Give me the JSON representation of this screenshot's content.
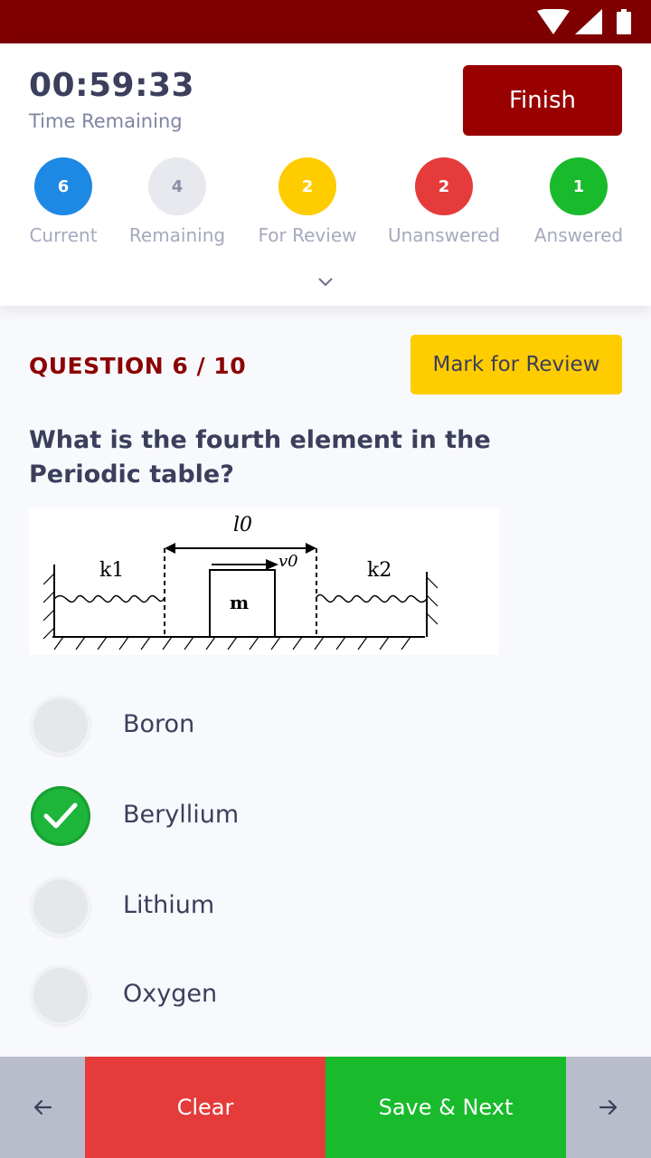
{
  "timer": {
    "value": "00:59:33",
    "label": "Time Remaining"
  },
  "finish_label": "Finish",
  "stats": [
    {
      "count": "6",
      "label": "Current",
      "color": "#1e88e5"
    },
    {
      "count": "4",
      "label": "Remaining",
      "color": "#e8e9ee"
    },
    {
      "count": "2",
      "label": "For Review",
      "color": "#ffcc00"
    },
    {
      "count": "2",
      "label": "Unanswered",
      "color": "#e53b3b"
    },
    {
      "count": "1",
      "label": "Answered",
      "color": "#19ba2c"
    }
  ],
  "question": {
    "number": "QUESTION 6 / 10",
    "review_label": "Mark for Review",
    "text": "What is the fourth element in the Periodic table?",
    "diagram": {
      "length_label": "l0",
      "velocity_label": "v0",
      "mass_label": "m",
      "spring1_label": "k1",
      "spring2_label": "k2"
    }
  },
  "options": [
    {
      "label": "Boron",
      "selected": false
    },
    {
      "label": "Beryllium",
      "selected": true
    },
    {
      "label": "Lithium",
      "selected": false
    },
    {
      "label": "Oxygen",
      "selected": false
    }
  ],
  "footer": {
    "prev_icon": "arrow-left-icon",
    "clear_label": "Clear",
    "save_label": "Save & Next",
    "next_icon": "arrow-right-icon"
  },
  "colors": {
    "status_bar": "#7e0000",
    "finish": "#990000",
    "question_number": "#8b0000",
    "review": "#ffcc00"
  }
}
